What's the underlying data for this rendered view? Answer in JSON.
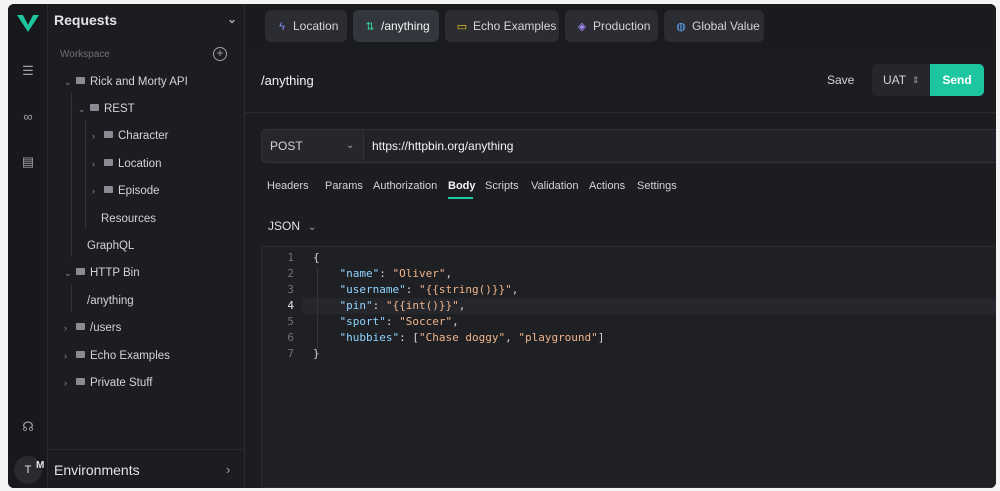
{
  "sidebar": {
    "title": "Requests",
    "workspace_label": "Workspace",
    "tree": [
      {
        "label": "Rick and Morty API",
        "kind": "folder",
        "open": true
      },
      {
        "label": "REST",
        "kind": "folder",
        "open": true
      },
      {
        "label": "Character",
        "kind": "folder",
        "open": false
      },
      {
        "label": "Location",
        "kind": "folder",
        "open": false
      },
      {
        "label": "Episode",
        "kind": "folder",
        "open": false
      },
      {
        "label": "Resources",
        "kind": "request"
      },
      {
        "label": "GraphQL",
        "kind": "request"
      },
      {
        "label": "HTTP Bin",
        "kind": "folder",
        "open": true
      },
      {
        "label": "/anything",
        "kind": "request"
      },
      {
        "label": "/users",
        "kind": "folder",
        "open": false
      },
      {
        "label": "Echo Examples",
        "kind": "folder",
        "open": false
      },
      {
        "label": "Private Stuff",
        "kind": "folder",
        "open": false
      }
    ],
    "environments_label": "Environments"
  },
  "user": {
    "initial": "T",
    "badge": "M"
  },
  "tabs": [
    {
      "label": "Location",
      "icon": "bolt-icon",
      "color": "#818cf8"
    },
    {
      "label": "/anything",
      "icon": "arrows-updown-icon",
      "color": "#34d399"
    },
    {
      "label": "Echo Examples",
      "icon": "folder-icon",
      "color": "#facc15"
    },
    {
      "label": "Production",
      "icon": "layers-icon",
      "color": "#a78bfa"
    },
    {
      "label": "Global Value",
      "icon": "globe-icon",
      "color": "#60a5fa"
    }
  ],
  "request": {
    "title": "/anything",
    "save_label": "Save",
    "environment": "UAT",
    "send_label": "Send",
    "method": "POST",
    "url": "https://httpbin.org/anything"
  },
  "subtabs": [
    "Headers",
    "Params",
    "Authorization",
    "Body",
    "Scripts",
    "Validation",
    "Actions",
    "Settings"
  ],
  "active_subtab": "Body",
  "body_format": "JSON",
  "code_lines": [
    "{",
    "    \"name\": \"Oliver\",",
    "    \"username\": \"{{string()}}\",",
    "    \"pin\": \"{{int()}}\",",
    "    \"sport\": \"Soccer\",",
    "    \"hubbies\": [\"Chase doggy\", \"playground\"]",
    "}"
  ],
  "line_numbers": [
    "1",
    "2",
    "3",
    "4",
    "5",
    "6",
    "7"
  ],
  "accent_color": "#1ec6a0"
}
